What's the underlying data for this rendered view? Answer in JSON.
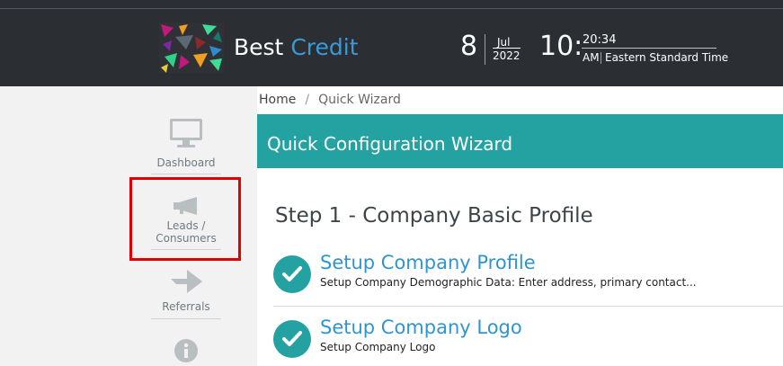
{
  "header": {
    "brand_part1": "Best",
    "brand_part2": "Credit",
    "date": {
      "day": "8",
      "month": "Jul",
      "year": "2022"
    },
    "time": {
      "hour": "10:",
      "minute": "20:34",
      "ampm": "AM",
      "zone": "Eastern Standard Time"
    },
    "colors": {
      "background": "#2b2e33",
      "brand_accent": "#3a9ad9"
    }
  },
  "sidebar": {
    "items": [
      {
        "label": "Dashboard",
        "icon": "monitor-icon"
      },
      {
        "label_line1": "Leads /",
        "label_line2": "Consumers",
        "icon": "megaphone-icon",
        "highlighted": true
      },
      {
        "label": "Referrals",
        "icon": "share-arrow-icon"
      },
      {
        "label": "",
        "icon": "info-icon"
      }
    ],
    "highlight_color": "#e00000"
  },
  "breadcrumb": {
    "home": "Home",
    "separator": "/",
    "current": "Quick Wizard"
  },
  "wizard": {
    "title": "Quick Configuration Wizard",
    "banner_color": "#24a2a2",
    "step_title": "Step 1 - Company Basic Profile",
    "tasks": [
      {
        "title": "Setup Company Profile",
        "description": "Setup Company Demographic Data: Enter address, primary contact...",
        "status": "complete"
      },
      {
        "title": "Setup Company Logo",
        "description": "Setup Company Logo",
        "status": "complete"
      }
    ]
  }
}
